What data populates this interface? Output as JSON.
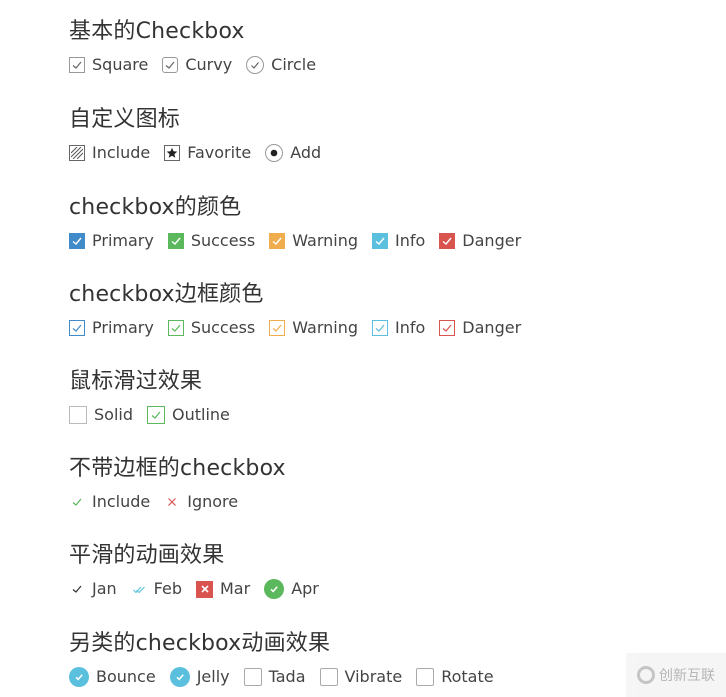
{
  "sections": [
    {
      "title": "基本的Checkbox",
      "items": [
        {
          "label": "Square",
          "style": "square",
          "checked": true
        },
        {
          "label": "Curvy",
          "style": "curvy",
          "checked": true
        },
        {
          "label": "Circle",
          "style": "circle",
          "checked": true
        }
      ]
    },
    {
      "title": "自定义图标",
      "items": [
        {
          "label": "Include",
          "icon": "hatch-icon",
          "checked": true
        },
        {
          "label": "Favorite",
          "icon": "star-icon",
          "checked": true
        },
        {
          "label": "Add",
          "icon": "dot-icon",
          "checked": true
        }
      ]
    },
    {
      "title": "checkbox的颜色",
      "items": [
        {
          "label": "Primary",
          "color": "#428bca",
          "checked": true
        },
        {
          "label": "Success",
          "color": "#5cb85c",
          "checked": true
        },
        {
          "label": "Warning",
          "color": "#f0ad4e",
          "checked": true
        },
        {
          "label": "Info",
          "color": "#5bc0de",
          "checked": true
        },
        {
          "label": "Danger",
          "color": "#d9534f",
          "checked": true
        }
      ]
    },
    {
      "title": "checkbox边框颜色",
      "items": [
        {
          "label": "Primary",
          "color": "#428bca",
          "checked": true
        },
        {
          "label": "Success",
          "color": "#5cb85c",
          "checked": true
        },
        {
          "label": "Warning",
          "color": "#f0ad4e",
          "checked": true
        },
        {
          "label": "Info",
          "color": "#5bc0de",
          "checked": true
        },
        {
          "label": "Danger",
          "color": "#d9534f",
          "checked": true
        }
      ]
    },
    {
      "title": "鼠标滑过效果",
      "items": [
        {
          "label": "Solid",
          "checked": false
        },
        {
          "label": "Outline",
          "color": "#5cb85c",
          "checked": true
        }
      ]
    },
    {
      "title": "不带边框的checkbox",
      "items": [
        {
          "label": "Include",
          "icon": "check-icon",
          "color": "#5cb85c",
          "checked": true
        },
        {
          "label": "Ignore",
          "icon": "cross-icon",
          "color": "#d9534f",
          "checked": true
        }
      ]
    },
    {
      "title": "平滑的动画效果",
      "items": [
        {
          "label": "Jan",
          "icon": "check-icon",
          "color": "#333333",
          "checked": true
        },
        {
          "label": "Feb",
          "icon": "double-check-icon",
          "color": "#5bc0de",
          "checked": true
        },
        {
          "label": "Mar",
          "icon": "cross-box-icon",
          "color": "#d9534f",
          "checked": true
        },
        {
          "label": "Apr",
          "icon": "check-circle-icon",
          "color": "#5cb85c",
          "checked": true
        }
      ]
    },
    {
      "title": "另类的checkbox动画效果",
      "items": [
        {
          "label": "Bounce",
          "color": "#5bc0de",
          "checked": true
        },
        {
          "label": "Jelly",
          "color": "#5bc0de",
          "checked": true
        },
        {
          "label": "Tada",
          "checked": false
        },
        {
          "label": "Vibrate",
          "checked": false
        },
        {
          "label": "Rotate",
          "checked": false
        }
      ]
    }
  ],
  "watermark": {
    "text": "创新互联"
  }
}
